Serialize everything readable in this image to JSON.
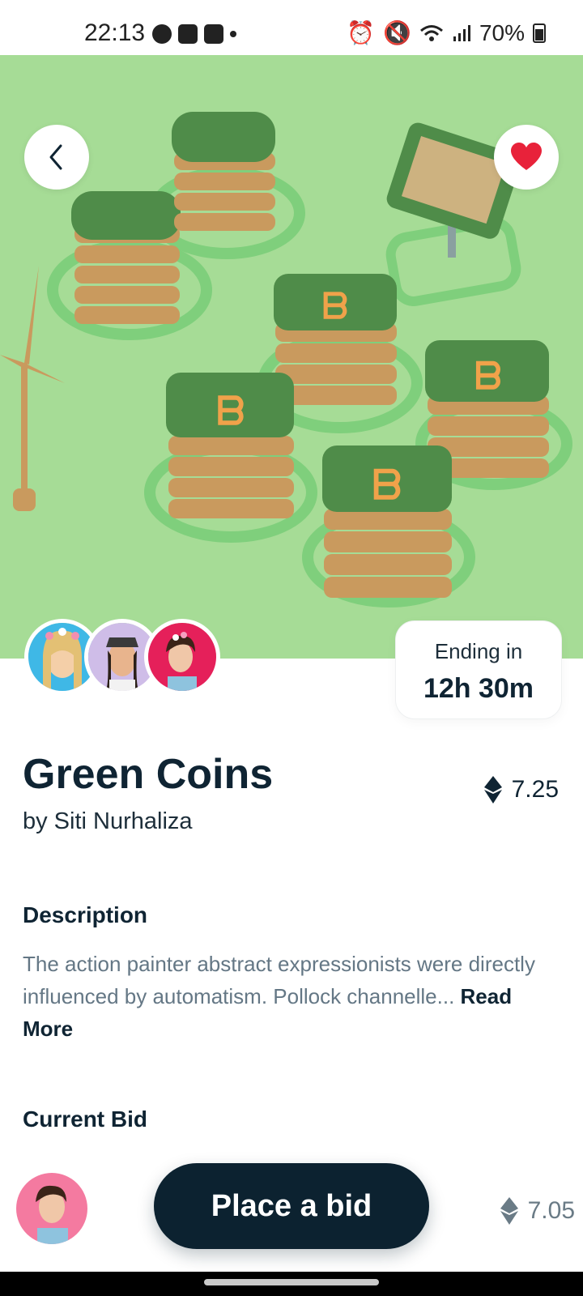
{
  "status_bar": {
    "time": "22:13",
    "battery": "70%"
  },
  "icons": {
    "back": "chevron-left-icon",
    "favorite": "heart-icon",
    "currency": "ethereum-icon"
  },
  "colors": {
    "hero_background": "#a6dc96",
    "primary_dark": "#0c2230",
    "favorite_red": "#e8223a",
    "muted_text": "#647785"
  },
  "auction": {
    "ending_label": "Ending in",
    "ending_value": "12h 30m"
  },
  "item": {
    "title": "Green Coins",
    "author": "by Siti Nurhaliza",
    "price": "7.25"
  },
  "description": {
    "heading": "Description",
    "text": "The action painter abstract expressionists were directly influenced by automatism. Pollock channelle...",
    "read_more": "Read More"
  },
  "current_bid": {
    "heading": "Current Bid",
    "price": "7.05"
  },
  "actions": {
    "place_bid": "Place a bid"
  }
}
